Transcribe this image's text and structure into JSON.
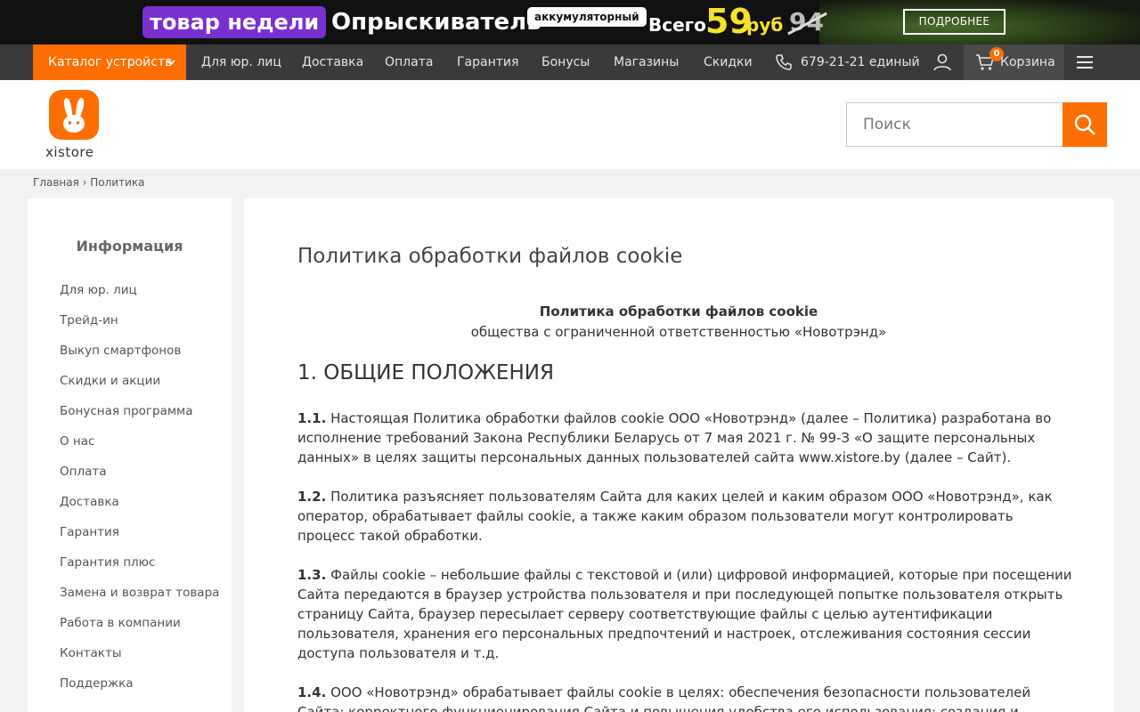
{
  "promo": {
    "badge": "товар недели",
    "product": "Опрыскиватель",
    "tag": "аккумуляторный",
    "all_label": "Всего",
    "price": "59",
    "currency": "руб",
    "old_price": "94",
    "more_button": "ПОДРОБНЕЕ"
  },
  "nav": {
    "catalog": "Каталог устройств",
    "links": [
      "Для юр. лиц",
      "Доставка",
      "Оплата",
      "Гарантия",
      "Бонусы",
      "Магазины",
      "Скидки"
    ],
    "phone": "679-21-21 единый",
    "cart_label": "Корзина",
    "cart_count": "0"
  },
  "header": {
    "logo_text": "xistore",
    "search_placeholder": "Поиск"
  },
  "breadcrumb": "Главная › Политика",
  "sidebar": {
    "title": "Информация",
    "items": [
      "Для юр. лиц",
      "Трейд-ин",
      "Выкуп смартфонов",
      "Скидки и акции",
      "Бонусная программа",
      "О нас",
      "Оплата",
      "Доставка",
      "Гарантия",
      "Гарантия плюс",
      "Замена и возврат товара",
      "Работа в компании",
      "Контакты",
      "Поддержка"
    ]
  },
  "content": {
    "page_title": "Политика обработки файлов cookie",
    "doc_title": "Политика обработки файлов cookie",
    "doc_subtitle": "общества с ограниченной ответственностью «Новотрэнд»",
    "section_heading": "1. ОБЩИЕ ПОЛОЖЕНИЯ",
    "paragraphs": [
      {
        "num": "1.1.",
        "text": "Настоящая Политика обработки файлов cookie ООО «Новотрэнд» (далее – Политика) разработана во исполнение требований Закона Республики Беларусь от 7 мая 2021 г. № 99-З «О защите персональных данных» в целях защиты персональных данных пользователей сайта www.xistore.by (далее – Сайт)."
      },
      {
        "num": "1.2.",
        "text": "Политика разъясняет пользователям Сайта для каких целей и каким образом ООО «Новотрэнд», как оператор, обрабатывает файлы cookie, а также каким образом пользователи могут контролировать процесс такой обработки."
      },
      {
        "num": "1.3.",
        "text": "Файлы cookie – небольшие файлы с текстовой и (или) цифровой информацией, которые при посещении Сайта передаются в браузер устройства пользователя и при последующей попытке пользователя открыть страницу Сайта, браузер пересылает серверу соответствующие файлы с целью аутентификации пользователя, хранения его персональных предпочтений и настроек, отслеживания состояния сессии доступа пользователя и т.д."
      },
      {
        "num": "1.4.",
        "text": "ООО «Новотрэнд» обрабатывает файлы cookie в целях: обеспечения безопасности пользователей Сайта; корректного функционирования Сайта и повышения удобства его использования; создания и"
      }
    ]
  }
}
